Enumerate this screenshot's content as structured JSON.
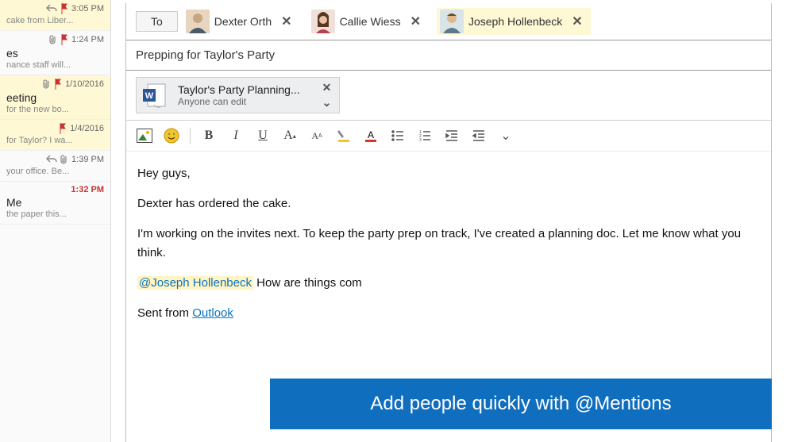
{
  "messages": [
    {
      "time": "3:05 PM",
      "title": "",
      "preview": "cake from Liber...",
      "highlighted": true,
      "icons": [
        "reply",
        "flag"
      ]
    },
    {
      "time": "1:24 PM",
      "title": "es",
      "preview": "nance staff will...",
      "highlighted": false,
      "icons": [
        "attach",
        "flag"
      ]
    },
    {
      "time": "1/10/2016",
      "title": "eeting",
      "preview": "for the new bo...",
      "highlighted": true,
      "icons": [
        "attach",
        "flag"
      ]
    },
    {
      "time": "1/4/2016",
      "title": "",
      "preview": "for Taylor? I wa...",
      "highlighted": true,
      "icons": [
        "flag"
      ]
    },
    {
      "time": "1:39 PM",
      "title": "",
      "preview": "your office. Be...",
      "highlighted": false,
      "icons": [
        "reply",
        "attach"
      ]
    },
    {
      "time": "1:32 PM",
      "title": "Me",
      "preview": "the paper this...",
      "highlighted": false,
      "icons": [],
      "time_red": true
    }
  ],
  "to_label": "To",
  "recipients": [
    {
      "name": "Dexter Orth",
      "highlighted": false,
      "avatar": "m1"
    },
    {
      "name": "Callie Wiess",
      "highlighted": false,
      "avatar": "f1"
    },
    {
      "name": "Joseph Hollenbeck",
      "highlighted": true,
      "avatar": "m2"
    }
  ],
  "subject": "Prepping for Taylor's Party",
  "attachment": {
    "name": "Taylor's Party Planning...",
    "subtitle": "Anyone can edit"
  },
  "body": {
    "p1": "Hey guys,",
    "p2": "Dexter has ordered the cake.",
    "p3": "I'm working on the invites next. To keep the party prep on track, I've created a planning doc. Let me know what you think.",
    "mention": "@Joseph Hollenbeck",
    "p4_rest": " How are things com",
    "sent_from": "Sent from ",
    "outlook": "Outlook"
  },
  "banner": "Add people quickly with @Mentions",
  "colors": {
    "accent": "#106ebe",
    "highlight": "#fff8d4",
    "flag": "#c93232"
  }
}
